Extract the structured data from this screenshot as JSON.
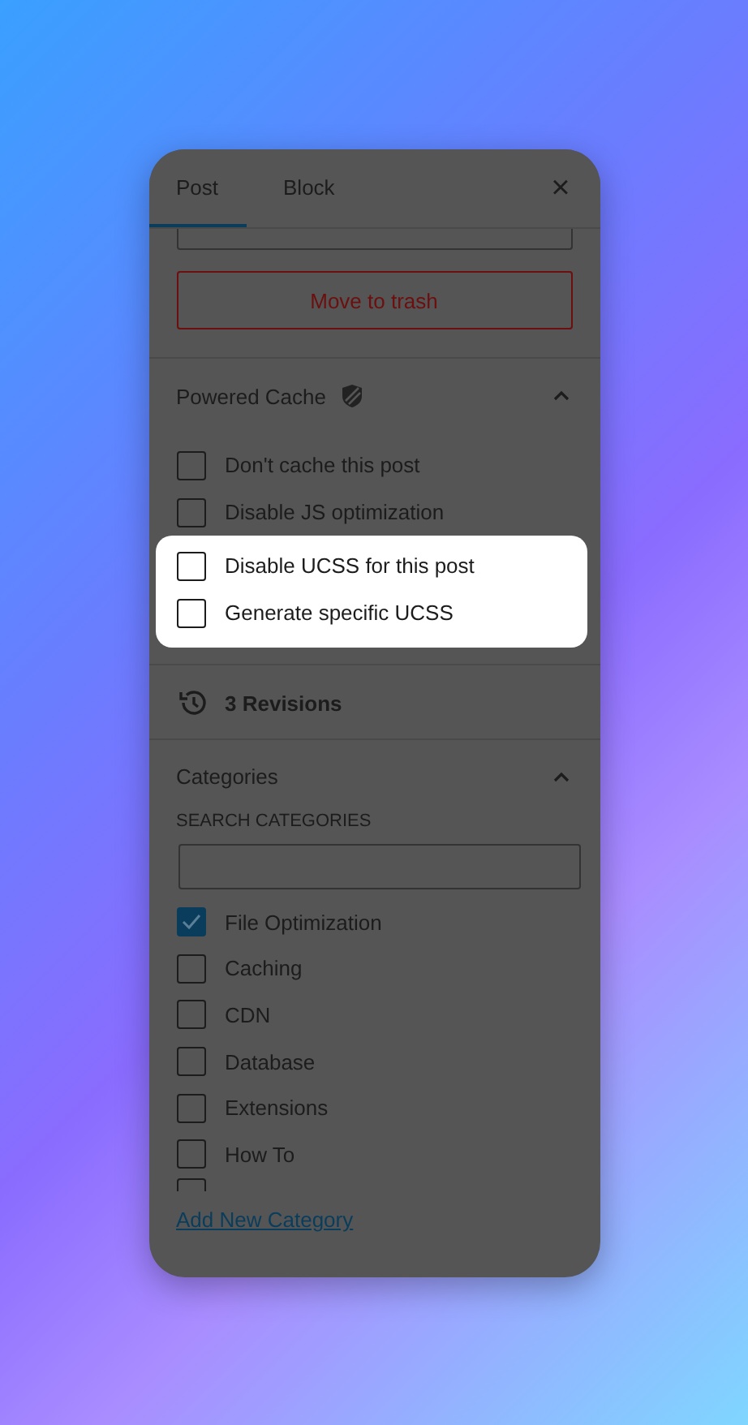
{
  "tabs": [
    {
      "label": "Post",
      "selected": true
    },
    {
      "label": "Block",
      "selected": false
    }
  ],
  "close_label": "×",
  "trash_button": "Move to trash",
  "powered_cache": {
    "title": "Powered Cache",
    "expanded": true,
    "options": [
      {
        "label": "Don't cache this post",
        "checked": false,
        "highlighted": false
      },
      {
        "label": "Disable JS optimization",
        "checked": false,
        "highlighted": false
      },
      {
        "label": "Disable UCSS for this post",
        "checked": false,
        "highlighted": true
      },
      {
        "label": "Generate specific UCSS",
        "checked": false,
        "highlighted": true
      }
    ]
  },
  "revisions": "3 Revisions",
  "categories": {
    "title": "Categories",
    "expanded": true,
    "search_label": "SEARCH CATEGORIES",
    "items": [
      {
        "label": "File Optimization",
        "checked": true
      },
      {
        "label": "Caching",
        "checked": false
      },
      {
        "label": "CDN",
        "checked": false
      },
      {
        "label": "Database",
        "checked": false
      },
      {
        "label": "Extensions",
        "checked": false
      },
      {
        "label": "How To",
        "checked": false
      }
    ],
    "partial": {
      "checked": false
    },
    "add_link": "Add New Category"
  }
}
